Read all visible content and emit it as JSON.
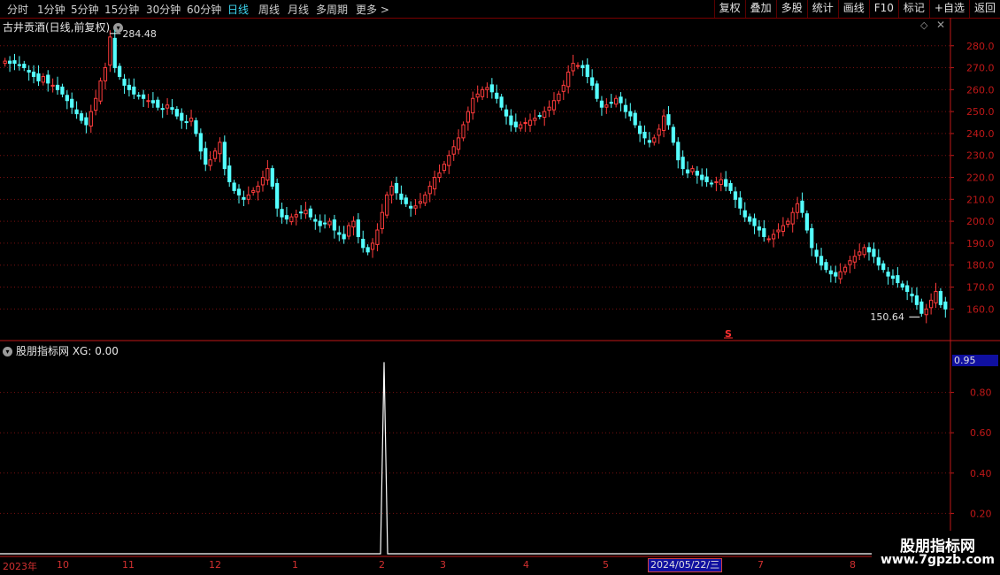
{
  "toolbar": {
    "periods": [
      "分时",
      "1分钟",
      "5分钟",
      "15分钟",
      "30分钟",
      "60分钟",
      "日线",
      "周线",
      "月线",
      "多周期",
      "更多 >"
    ],
    "active_period": "日线",
    "tools": [
      "复权",
      "叠加",
      "多股",
      "统计",
      "画线",
      "F10",
      "标记",
      "+自选",
      "返回"
    ]
  },
  "main_chart": {
    "title": "古井贡酒(日线,前复权)",
    "max_label": "284.48",
    "min_label": "150.64",
    "marker": "S",
    "y_ticks": [
      "280.0",
      "270.0",
      "260.0",
      "250.0",
      "240.0",
      "230.0",
      "220.0",
      "210.0",
      "200.0",
      "190.0",
      "180.0",
      "170.0",
      "160.0"
    ]
  },
  "sub_chart": {
    "title": "股朋指标网 XG: 0.00",
    "current_value": "0.95",
    "y_ticks": [
      "0.80",
      "0.60",
      "0.40",
      "0.20"
    ]
  },
  "x_axis": {
    "labels": [
      "2023年",
      "10",
      "11",
      "12",
      "1",
      "2",
      "3",
      "4",
      "5",
      "7",
      "8"
    ],
    "highlight": "2024/05/22/三"
  },
  "watermark": {
    "line1": "股朋指标网",
    "line2": "www.7gpzb.com"
  },
  "colors": {
    "up": "#ff3c3c",
    "down": "#54ffff",
    "axis": "#c01818",
    "grid": "#7a1010",
    "signal": "#ffffff",
    "bg": "#000000"
  },
  "chart_data": {
    "type": "candlestick",
    "ylim": [
      146,
      292
    ],
    "series": [
      {
        "name": "close",
        "values": [
          273,
          272,
          272,
          271,
          270,
          268,
          266,
          264,
          266,
          263,
          262,
          260,
          258,
          255,
          252,
          249,
          246,
          244,
          250,
          256,
          264,
          270,
          284,
          270,
          266,
          262,
          260,
          258,
          257,
          256,
          255,
          254,
          252,
          251,
          253,
          251,
          248,
          246,
          245,
          247,
          240,
          232,
          226,
          228,
          232,
          236,
          224,
          218,
          214,
          212,
          210,
          212,
          214,
          216,
          220,
          224,
          216,
          206,
          202,
          201,
          202,
          203,
          204,
          205,
          202,
          200,
          198,
          199,
          200,
          196,
          194,
          192,
          198,
          200,
          193,
          188,
          186,
          190,
          196,
          204,
          212,
          216,
          213,
          210,
          208,
          206,
          207,
          209,
          212,
          216,
          220,
          222,
          226,
          230,
          234,
          238,
          244,
          250,
          256,
          258,
          260,
          261,
          259,
          256,
          252,
          248,
          244,
          243,
          244,
          245,
          246,
          247,
          248,
          250,
          252,
          255,
          258,
          262,
          268,
          272,
          271,
          270,
          266,
          262,
          256,
          252,
          253,
          254,
          256,
          254,
          250,
          248,
          244,
          240,
          238,
          236,
          238,
          242,
          248,
          244,
          236,
          228,
          224,
          222,
          224,
          221,
          219,
          218,
          217,
          218,
          219,
          216,
          214,
          210,
          206,
          202,
          200,
          198,
          196,
          193,
          192,
          194,
          196,
          198,
          200,
          204,
          208,
          204,
          196,
          188,
          184,
          180,
          178,
          176,
          175,
          177,
          179,
          182,
          184,
          186,
          188,
          186,
          184,
          180,
          178,
          175,
          174,
          172,
          170,
          168,
          166,
          162,
          158,
          160,
          164,
          168,
          162,
          160
        ]
      }
    ],
    "signal": {
      "name": "XG",
      "peak": 0.95,
      "peak_date": "2024-02"
    },
    "sub_ylim": [
      0,
      1
    ]
  }
}
